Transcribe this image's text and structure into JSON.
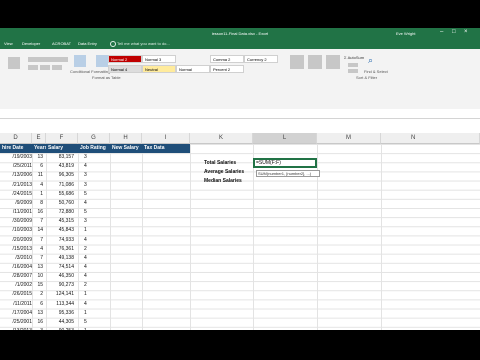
{
  "window": {
    "title": "lesson11-Final Data.xlsx - Excel",
    "user": "Eve Wright"
  },
  "tabs": [
    "View",
    "Developer",
    "ACROBAT",
    "Data Entry"
  ],
  "tell_me": "Tell me what you want to do...",
  "ribbon": {
    "conditional_formatting": "Conditional Formatting",
    "format_as_table": "Format as Table",
    "cell_styles": [
      "Normal 2",
      "Normal 3",
      "Normal 4",
      "Comma 2",
      "Currency 2",
      "Percent 2",
      "Normal",
      "Neutral"
    ],
    "sort_filter": "Sort & Filter",
    "find_select": "Find & Select",
    "autosum": "AutoSum"
  },
  "columns": {
    "headers": [
      "D",
      "E",
      "F",
      "G",
      "H",
      "I",
      "K",
      "L",
      "M",
      "N"
    ],
    "table_headers": [
      "hire Date",
      "Years",
      "Salary",
      "Job Rating",
      "New Salary",
      "Tax Data"
    ]
  },
  "rows": [
    {
      "date": "/19/2003",
      "years": "13",
      "salary": "83,157",
      "rating": "3"
    },
    {
      "date": "/25/2011",
      "years": "6",
      "salary": "43,819",
      "rating": "4"
    },
    {
      "date": "/13/2006",
      "years": "11",
      "salary": "96,305",
      "rating": "3"
    },
    {
      "date": "/21/2013",
      "years": "4",
      "salary": "71,086",
      "rating": "3"
    },
    {
      "date": "/24/2015",
      "years": "1",
      "salary": "55,686",
      "rating": "5"
    },
    {
      "date": "/9/2009",
      "years": "8",
      "salary": "50,760",
      "rating": "4"
    },
    {
      "date": "/11/2001",
      "years": "16",
      "salary": "72,880",
      "rating": "5"
    },
    {
      "date": "/30/2009",
      "years": "7",
      "salary": "45,315",
      "rating": "3"
    },
    {
      "date": "/10/2003",
      "years": "14",
      "salary": "45,843",
      "rating": "1"
    },
    {
      "date": "/20/2009",
      "years": "7",
      "salary": "74,933",
      "rating": "4"
    },
    {
      "date": "/15/2013",
      "years": "4",
      "salary": "76,361",
      "rating": "2"
    },
    {
      "date": "/3/2010",
      "years": "7",
      "salary": "49,138",
      "rating": "4"
    },
    {
      "date": "/16/2004",
      "years": "13",
      "salary": "74,514",
      "rating": "4"
    },
    {
      "date": "/28/2007",
      "years": "10",
      "salary": "46,350",
      "rating": "4"
    },
    {
      "date": "/1/2002",
      "years": "15",
      "salary": "90,273",
      "rating": "2"
    },
    {
      "date": "/26/2015",
      "years": "2",
      "salary": "124,141",
      "rating": "1"
    },
    {
      "date": "/11/2011",
      "years": "6",
      "salary": "113,344",
      "rating": "4"
    },
    {
      "date": "/17/2004",
      "years": "13",
      "salary": "95,336",
      "rating": "1"
    },
    {
      "date": "/25/2001",
      "years": "16",
      "salary": "44,305",
      "rating": "5"
    },
    {
      "date": "/13/2013",
      "years": "3",
      "salary": "90,253",
      "rating": "1"
    },
    {
      "date": "/19/2010",
      "years": "7",
      "salary": "59,922",
      "rating": "3"
    },
    {
      "date": "/20/2014",
      "years": "2",
      "salary": "83,272",
      "rating": "2"
    },
    {
      "date": "/10/2001",
      "years": "17",
      "salary": "115,351",
      "rating": "1"
    },
    {
      "date": "/9/2010",
      "years": "7",
      "salary": "83,336",
      "rating": "3"
    }
  ],
  "summary": {
    "total_label": "Total Salaries",
    "average_label": "Average Salaries",
    "median_label": "Median Salaries",
    "formula": "=SUM(F:F)",
    "tooltip": "SUM(number1, [number2], ...)"
  },
  "colors": {
    "excel_green": "#217346",
    "header_blue": "#1f4e79"
  }
}
